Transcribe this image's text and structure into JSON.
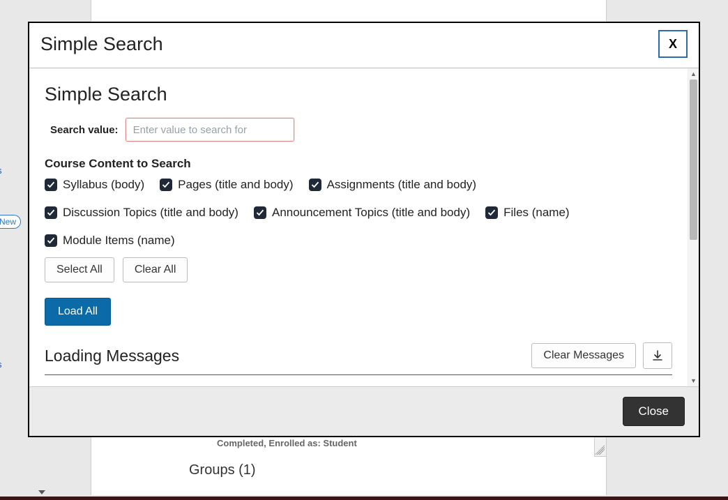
{
  "background": {
    "sidebar_s1": "s",
    "sidebar_new": "New",
    "sidebar_s2": "s",
    "status_line": "Completed, Enrolled as: Student",
    "groups_heading": "Groups (1)"
  },
  "modal": {
    "title": "Simple Search",
    "close_x": "X",
    "heading": "Simple Search",
    "search_label": "Search value:",
    "search_placeholder": "Enter value to search for",
    "section_heading": "Course Content to Search",
    "checks": [
      {
        "label": "Syllabus (body)",
        "checked": true
      },
      {
        "label": "Pages (title and body)",
        "checked": true
      },
      {
        "label": "Assignments (title and body)",
        "checked": true
      },
      {
        "label": "Discussion Topics (title and body)",
        "checked": true
      },
      {
        "label": "Announcement Topics (title and body)",
        "checked": true
      },
      {
        "label": "Files (name)",
        "checked": true
      },
      {
        "label": "Module Items (name)",
        "checked": true
      }
    ],
    "select_all": "Select All",
    "clear_all": "Clear All",
    "load_all": "Load All",
    "messages_heading": "Loading Messages",
    "clear_messages": "Clear Messages",
    "footer_close": "Close"
  }
}
